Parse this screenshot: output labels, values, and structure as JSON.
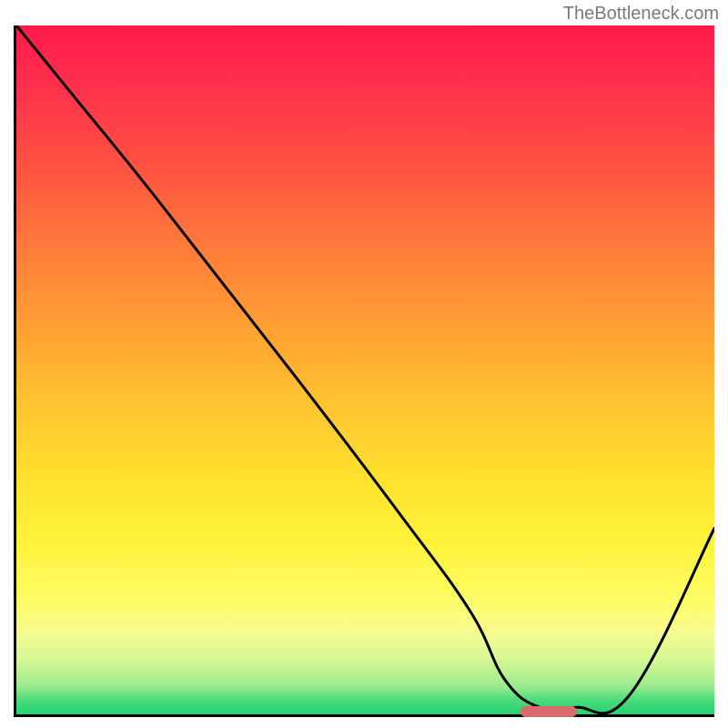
{
  "watermark": "TheBottleneck.com",
  "chart_data": {
    "type": "line",
    "title": "",
    "xlabel": "",
    "ylabel": "",
    "xlim": [
      0,
      100
    ],
    "ylim": [
      0,
      100
    ],
    "x": [
      0,
      8,
      20,
      40,
      55,
      65,
      70,
      75,
      80,
      88,
      100
    ],
    "values": [
      100,
      90,
      75,
      49,
      29,
      15,
      5,
      1,
      1,
      3,
      27
    ],
    "annotations": [
      {
        "type": "marker",
        "x_start": 72,
        "x_end": 80,
        "y": 0.8,
        "color": "#d96b6f"
      }
    ],
    "background_gradient": {
      "top": "#ff1a4a",
      "mid": "#ffe22e",
      "bottom": "#25d370"
    }
  }
}
